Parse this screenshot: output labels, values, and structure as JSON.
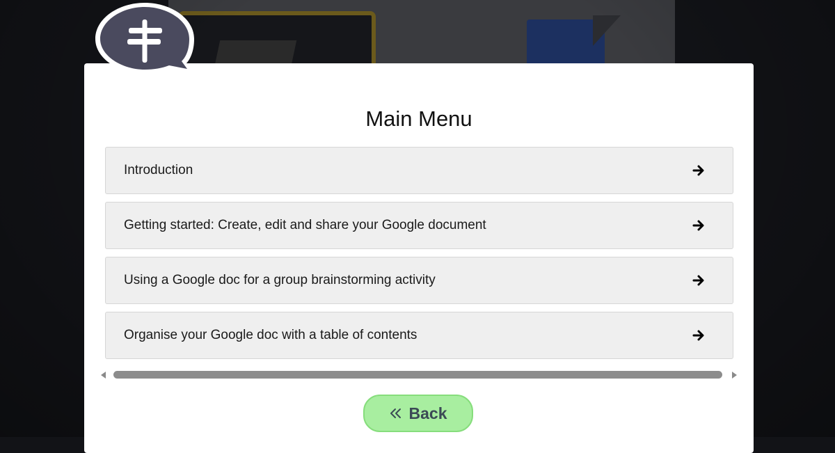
{
  "page": {
    "title": "Main Menu"
  },
  "menu": {
    "items": [
      {
        "label": "Introduction",
        "icon": "arrow-right-icon"
      },
      {
        "label": "Getting started: Create, edit and share your Google document",
        "icon": "arrow-right-icon"
      },
      {
        "label": "Using a Google doc for a group brainstorming activity",
        "icon": "arrow-right-icon"
      },
      {
        "label": "Organise your Google doc with a table of contents",
        "icon": "arrow-right-icon"
      }
    ]
  },
  "back_button": {
    "label": "Back",
    "icon": "double-chevron-left-icon"
  },
  "logo": {
    "icon": "signpost-icon"
  },
  "colors": {
    "background": "#121317",
    "panel": "#ffffff",
    "menu_item_bg": "#efefef",
    "back_button_bg": "#a8eea0",
    "logo_bubble": "#4a4a5e"
  }
}
